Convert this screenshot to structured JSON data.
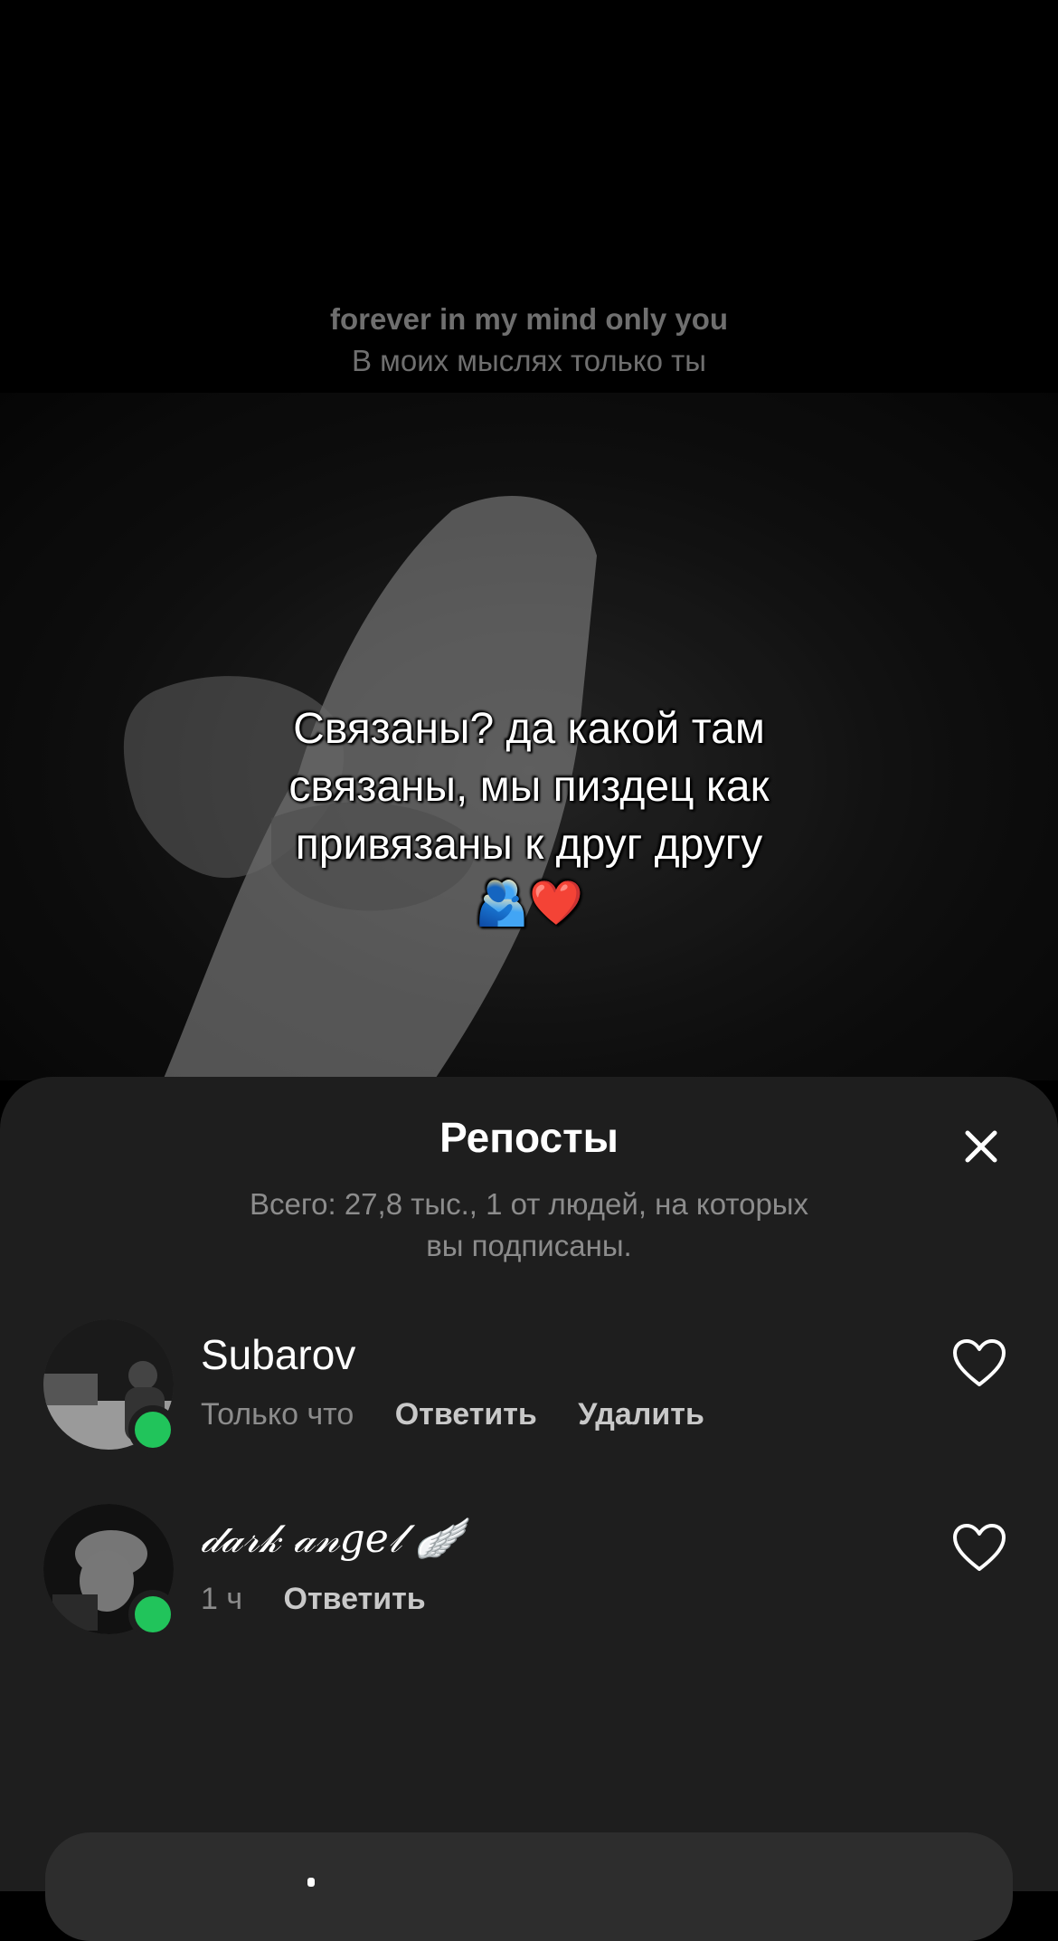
{
  "lyrics": {
    "line_en": "forever in my mind only you",
    "line_ru": "В моих мыслях только ты"
  },
  "video": {
    "caption_line1": "Связаны? да какой там",
    "caption_line2": "связаны, мы пиздец как",
    "caption_line3": "привязаны к друг другу",
    "caption_emoji": "🫂❤️"
  },
  "sheet": {
    "title": "Репосты",
    "summary_line1": "Всего: 27,8 тыс., 1 от людей, на которых",
    "summary_line2": "вы подписаны."
  },
  "reposts": [
    {
      "username": "Subarov",
      "time": "Только что",
      "reply": "Ответить",
      "delete": "Удалить",
      "online": true
    },
    {
      "username": "𝒹𝒶𝓇𝓀 𝒶𝓃𝑔𝑒𝓁 🪽",
      "time": "1 ч",
      "reply": "Ответить",
      "online": true
    }
  ],
  "colors": {
    "sheet_bg": "#1e1e1e",
    "online": "#21c45b",
    "muted_text": "#8c8c8c"
  },
  "icons": [
    "close-icon",
    "heart-icon"
  ]
}
